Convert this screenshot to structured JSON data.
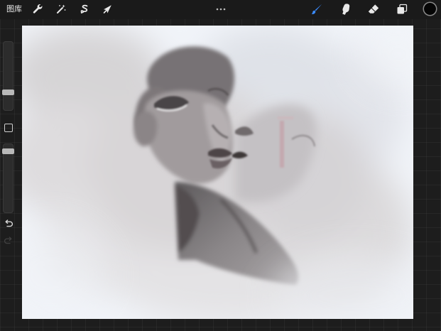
{
  "toolbar": {
    "gallery_label": "图库",
    "tools_left": [
      {
        "name": "actions",
        "icon": "wrench-icon"
      },
      {
        "name": "adjustments",
        "icon": "magic-wand-icon"
      },
      {
        "name": "selection",
        "icon": "selection-s-icon"
      },
      {
        "name": "transform",
        "icon": "arrow-cursor-icon"
      }
    ],
    "more_icon": "more-dots-icon",
    "tools_right": [
      {
        "name": "brush",
        "icon": "brush-icon",
        "active": true,
        "color": "#3b8cff"
      },
      {
        "name": "smudge",
        "icon": "smudge-finger-icon"
      },
      {
        "name": "eraser",
        "icon": "eraser-icon"
      },
      {
        "name": "layers",
        "icon": "layers-icon"
      }
    ],
    "current_color": "#050505"
  },
  "sidebar": {
    "brush_size": 0.24,
    "brush_opacity": 0.92,
    "modify_icon": "square-modify-icon",
    "undo_icon": "undo-arrow-icon",
    "redo_icon": "redo-arrow-icon"
  },
  "canvas": {
    "background": "#f1f4f9",
    "subject": "painting"
  }
}
